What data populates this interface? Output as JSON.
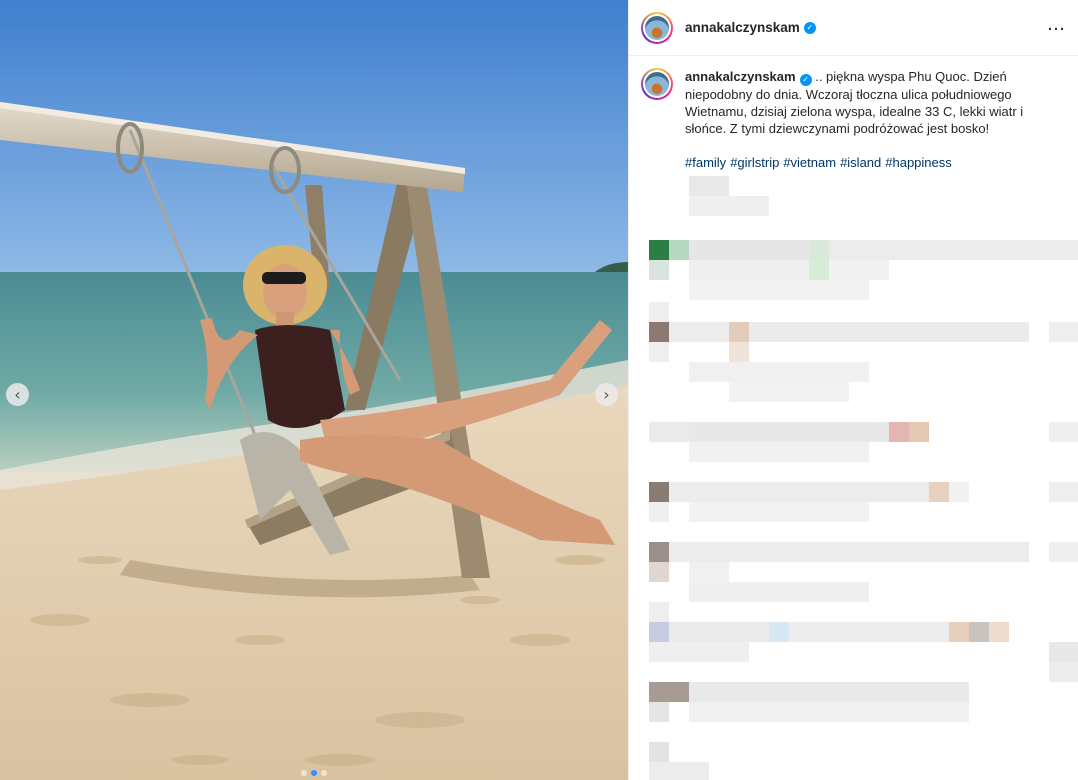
{
  "post": {
    "username": "annakalczynskam",
    "verified": true,
    "more_icon": "…"
  },
  "caption": {
    "username": "annakalczynskam",
    "text": ".. piękna wyspa Phu Quoc. Dzień niepodobny do dnia. Wczoraj tłoczna ulica południowego Wietnamu, dzisiaj zielona wyspa, idealne 33 C, lekki wiatr i słońce. Z tymi dziewczynami podróżować jest bosko!",
    "hashtags": [
      "#family",
      "#girlstrip",
      "#vietnam",
      "#island",
      "#happiness"
    ]
  },
  "carousel": {
    "prev_icon": "‹",
    "next_icon": "›",
    "slide_count": 3,
    "active_slide": 2
  },
  "colors": {
    "link": "#00376b",
    "verified": "#0095f6",
    "text": "#262626"
  }
}
